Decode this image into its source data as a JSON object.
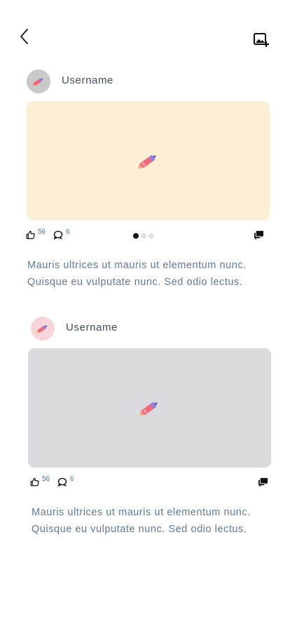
{
  "header": {
    "back_icon": "chevron-left-icon",
    "add_image_icon": "add-image-icon"
  },
  "posts": [
    {
      "username": "Username",
      "avatar_icon": "pencil-icon",
      "avatar_bg": "#c9c9cc",
      "media_bg": "#fcefd5",
      "media_icon": "pencil-icon",
      "likes": "56",
      "comments": "6",
      "carousel": {
        "count": 3,
        "active": 0
      },
      "caption": "Mauris ultrices ut mauris ut elementum nunc. Quisque eu vulputate nunc. Sed odio lectus."
    },
    {
      "username": "Username",
      "avatar_icon": "pencil-icon",
      "avatar_bg": "#f8d5d9",
      "media_bg": "#dadadf",
      "media_icon": "pencil-icon",
      "likes": "56",
      "comments": "6",
      "caption": "Mauris ultrices ut mauris ut elementum nunc. Quisque eu vulputate nunc. Sed odio lectus."
    }
  ]
}
